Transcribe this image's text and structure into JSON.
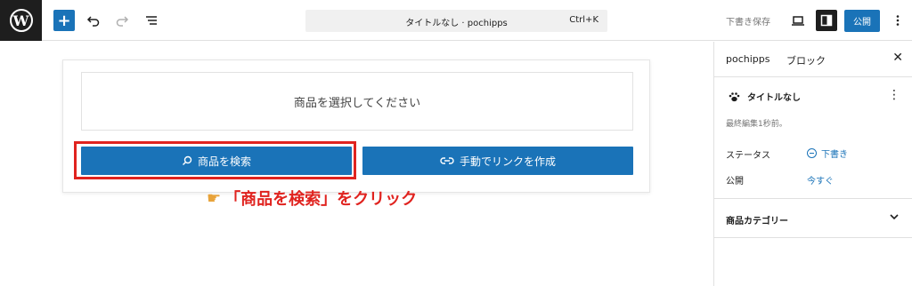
{
  "toolbar": {
    "command_title": "タイトルなし · pochipps",
    "command_shortcut": "Ctrl+K",
    "save_draft_label": "下書き保存",
    "publish_label": "公開"
  },
  "block": {
    "placeholder_text": "商品を選択してください",
    "search_button_label": "商品を検索",
    "manual_link_button_label": "手動でリンクを作成"
  },
  "annotation": {
    "text": "「商品を検索」をクリック"
  },
  "sidebar": {
    "tabs": [
      {
        "label": "pochipps"
      },
      {
        "label": "ブロック"
      }
    ],
    "document": {
      "title": "タイトルなし",
      "last_edited": "最終編集1秒前。",
      "status_label": "ステータス",
      "status_value": "下書き",
      "publish_label": "公開",
      "publish_value": "今すぐ"
    },
    "category_panel_title": "商品カテゴリー"
  },
  "colors": {
    "accent": "#1a73b8",
    "highlight": "#e0231f",
    "dark": "#1e1e1e"
  }
}
